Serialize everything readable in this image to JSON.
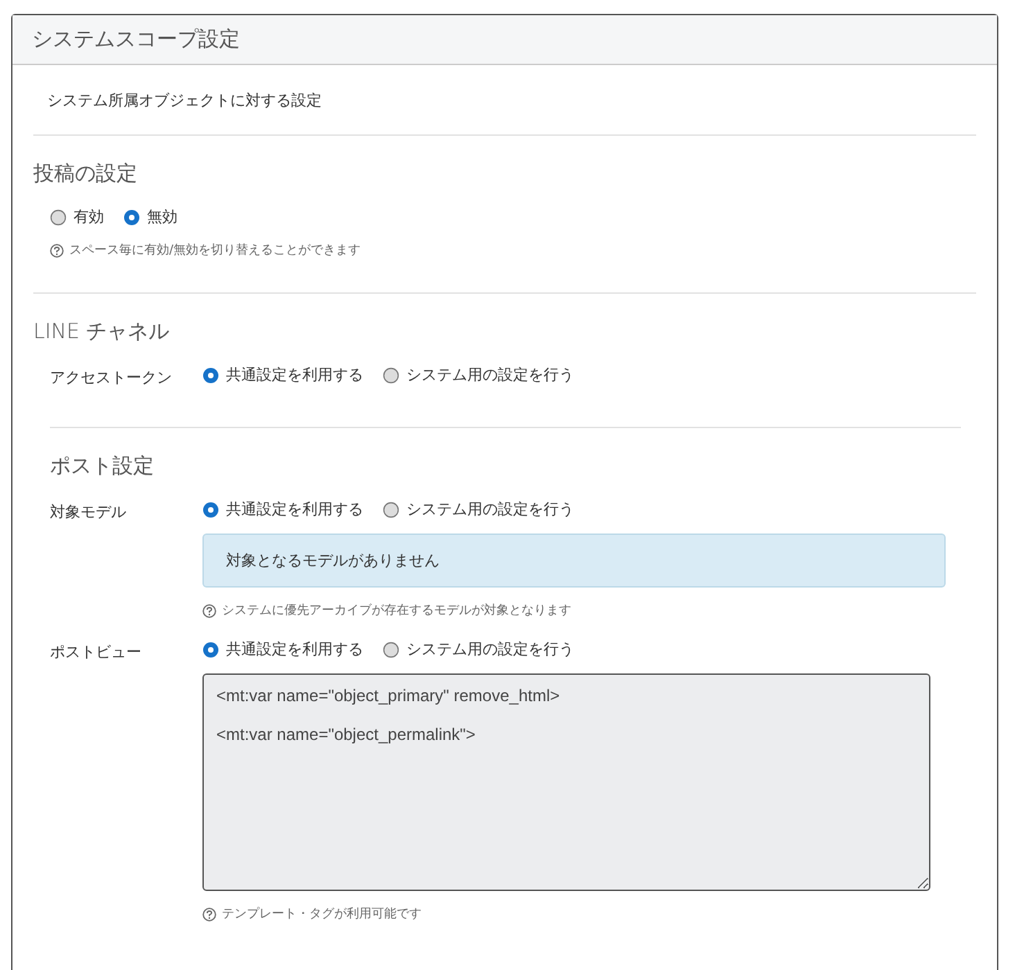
{
  "panel": {
    "title": "システムスコープ設定",
    "description": "システム所属オブジェクトに対する設定",
    "sections": [
      {
        "heading": "投稿の設定",
        "rows": [
          {
            "options": [
              {
                "label": "有効",
                "selected": false
              },
              {
                "label": "無効",
                "selected": true
              }
            ],
            "help": "スペース毎に有効/無効を切り替えることができます"
          }
        ]
      },
      {
        "heading": "LINE チャネル",
        "rows": [
          {
            "label": "アクセストークン",
            "options": [
              {
                "label": "共通設定を利用する",
                "selected": true
              },
              {
                "label": "システム用の設定を行う",
                "selected": false
              }
            ]
          }
        ],
        "subsections": [
          {
            "heading": "ポスト設定",
            "rows": [
              {
                "label": "対象モデル",
                "options": [
                  {
                    "label": "共通設定を利用する",
                    "selected": true
                  },
                  {
                    "label": "システム用の設定を行う",
                    "selected": false
                  }
                ],
                "alert": "対象となるモデルがありません",
                "help": "システムに優先アーカイブが存在するモデルが対象となります"
              },
              {
                "label": "ポストビュー",
                "options": [
                  {
                    "label": "共通設定を利用する",
                    "selected": true
                  },
                  {
                    "label": "システム用の設定を行う",
                    "selected": false
                  }
                ],
                "textarea": "<mt:var name=\"object_primary\" remove_html>\n\n<mt:var name=\"object_permalink\">",
                "help": "テンプレート・タグが利用可能です"
              }
            ]
          }
        ]
      }
    ]
  }
}
